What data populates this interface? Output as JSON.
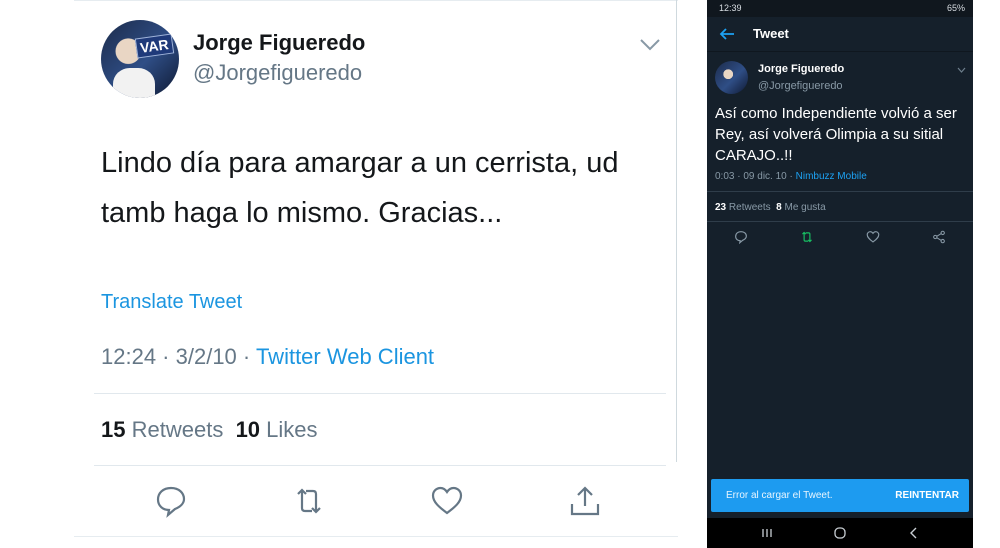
{
  "left_tweet": {
    "name": "Jorge Figueredo",
    "handle": "@Jorgefigueredo",
    "avatar_badge": "VAR",
    "text": "Lindo día para amargar a un cerrista, ud tamb haga lo mismo. Gracias...",
    "translate": "Translate Tweet",
    "time": "12:24",
    "date": "3/2/10",
    "source": "Twitter Web Client",
    "retweets_count": "15",
    "retweets_label": "Retweets",
    "likes_count": "10",
    "likes_label": "Likes",
    "separator": " · ",
    "actions": [
      "reply-icon",
      "retweet-icon",
      "like-icon",
      "share-icon"
    ]
  },
  "mobile": {
    "status_time": "12:39",
    "status_right": "65%",
    "title": "Tweet",
    "name": "Jorge Figueredo",
    "handle": "@Jorgefigueredo",
    "text": "Así como Independiente volvió a ser Rey, así volverá Olimpia a su sitial CARAJO..!!",
    "time": "0:03",
    "date": "09 dic. 10",
    "source": "Nimbuzz Mobile",
    "retweets_count": "23",
    "retweets_label": "Retweets",
    "likes_count": "8",
    "likes_label": "Me gusta",
    "separator": " · ",
    "snackbar_text": "Error al cargar el Tweet.",
    "snackbar_button": "REINTENTAR",
    "colors": {
      "background": "#15202b",
      "accent": "#1da1f2",
      "retweet_green": "#17bf63"
    }
  }
}
